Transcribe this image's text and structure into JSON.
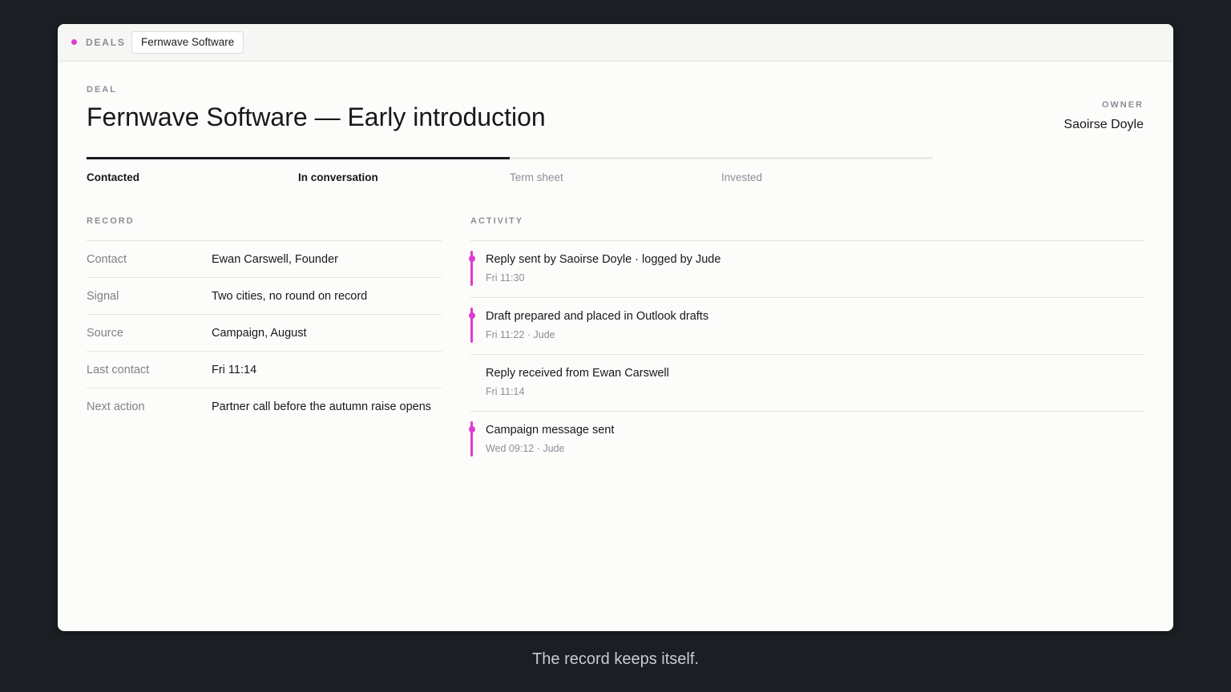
{
  "colors": {
    "accent": "#e03bd0",
    "background": "#1b1e23",
    "panel": "#fcfcfa"
  },
  "topbar": {
    "section_label": "DEALS",
    "breadcrumb": "Fernwave Software"
  },
  "deal": {
    "eyebrow": "DEAL",
    "title": "Fernwave Software — Early introduction"
  },
  "owner": {
    "eyebrow": "OWNER",
    "name": "Saoirse Doyle"
  },
  "pipeline": {
    "current_stage": "In conversation",
    "stages": [
      {
        "label": "Contacted",
        "done": true
      },
      {
        "label": "In conversation",
        "done": true
      },
      {
        "label": "Term sheet",
        "done": false
      },
      {
        "label": "Invested",
        "done": false
      }
    ]
  },
  "record": {
    "heading": "RECORD",
    "rows": [
      {
        "key": "Contact",
        "value": "Ewan Carswell, Founder"
      },
      {
        "key": "Signal",
        "value": "Two cities, no round on record"
      },
      {
        "key": "Source",
        "value": "Campaign, August"
      },
      {
        "key": "Last contact",
        "value": "Fri 11:14"
      },
      {
        "key": "Next action",
        "value": "Partner call before the autumn raise opens"
      }
    ]
  },
  "activity": {
    "heading": "ACTIVITY",
    "items": [
      {
        "text": "Reply sent by Saoirse Doyle · logged by Jude",
        "meta": "Fri 11:30",
        "marked": true
      },
      {
        "text": "Draft prepared and placed in Outlook drafts",
        "meta": "Fri 11:22 · Jude",
        "marked": true
      },
      {
        "text": "Reply received from Ewan Carswell",
        "meta": "Fri 11:14",
        "marked": false
      },
      {
        "text": "Campaign message sent",
        "meta": "Wed 09:12 · Jude",
        "marked": true
      }
    ]
  },
  "caption": "The record keeps itself."
}
